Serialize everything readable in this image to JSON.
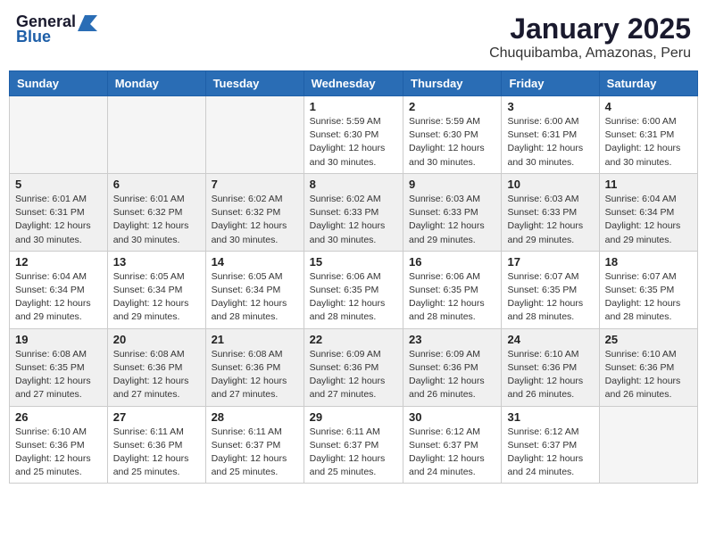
{
  "header": {
    "logo_general": "General",
    "logo_blue": "Blue",
    "month_title": "January 2025",
    "location": "Chuquibamba, Amazonas, Peru"
  },
  "days_of_week": [
    "Sunday",
    "Monday",
    "Tuesday",
    "Wednesday",
    "Thursday",
    "Friday",
    "Saturday"
  ],
  "weeks": [
    [
      {
        "day": "",
        "detail": ""
      },
      {
        "day": "",
        "detail": ""
      },
      {
        "day": "",
        "detail": ""
      },
      {
        "day": "1",
        "detail": "Sunrise: 5:59 AM\nSunset: 6:30 PM\nDaylight: 12 hours\nand 30 minutes."
      },
      {
        "day": "2",
        "detail": "Sunrise: 5:59 AM\nSunset: 6:30 PM\nDaylight: 12 hours\nand 30 minutes."
      },
      {
        "day": "3",
        "detail": "Sunrise: 6:00 AM\nSunset: 6:31 PM\nDaylight: 12 hours\nand 30 minutes."
      },
      {
        "day": "4",
        "detail": "Sunrise: 6:00 AM\nSunset: 6:31 PM\nDaylight: 12 hours\nand 30 minutes."
      }
    ],
    [
      {
        "day": "5",
        "detail": "Sunrise: 6:01 AM\nSunset: 6:31 PM\nDaylight: 12 hours\nand 30 minutes."
      },
      {
        "day": "6",
        "detail": "Sunrise: 6:01 AM\nSunset: 6:32 PM\nDaylight: 12 hours\nand 30 minutes."
      },
      {
        "day": "7",
        "detail": "Sunrise: 6:02 AM\nSunset: 6:32 PM\nDaylight: 12 hours\nand 30 minutes."
      },
      {
        "day": "8",
        "detail": "Sunrise: 6:02 AM\nSunset: 6:33 PM\nDaylight: 12 hours\nand 30 minutes."
      },
      {
        "day": "9",
        "detail": "Sunrise: 6:03 AM\nSunset: 6:33 PM\nDaylight: 12 hours\nand 29 minutes."
      },
      {
        "day": "10",
        "detail": "Sunrise: 6:03 AM\nSunset: 6:33 PM\nDaylight: 12 hours\nand 29 minutes."
      },
      {
        "day": "11",
        "detail": "Sunrise: 6:04 AM\nSunset: 6:34 PM\nDaylight: 12 hours\nand 29 minutes."
      }
    ],
    [
      {
        "day": "12",
        "detail": "Sunrise: 6:04 AM\nSunset: 6:34 PM\nDaylight: 12 hours\nand 29 minutes."
      },
      {
        "day": "13",
        "detail": "Sunrise: 6:05 AM\nSunset: 6:34 PM\nDaylight: 12 hours\nand 29 minutes."
      },
      {
        "day": "14",
        "detail": "Sunrise: 6:05 AM\nSunset: 6:34 PM\nDaylight: 12 hours\nand 28 minutes."
      },
      {
        "day": "15",
        "detail": "Sunrise: 6:06 AM\nSunset: 6:35 PM\nDaylight: 12 hours\nand 28 minutes."
      },
      {
        "day": "16",
        "detail": "Sunrise: 6:06 AM\nSunset: 6:35 PM\nDaylight: 12 hours\nand 28 minutes."
      },
      {
        "day": "17",
        "detail": "Sunrise: 6:07 AM\nSunset: 6:35 PM\nDaylight: 12 hours\nand 28 minutes."
      },
      {
        "day": "18",
        "detail": "Sunrise: 6:07 AM\nSunset: 6:35 PM\nDaylight: 12 hours\nand 28 minutes."
      }
    ],
    [
      {
        "day": "19",
        "detail": "Sunrise: 6:08 AM\nSunset: 6:35 PM\nDaylight: 12 hours\nand 27 minutes."
      },
      {
        "day": "20",
        "detail": "Sunrise: 6:08 AM\nSunset: 6:36 PM\nDaylight: 12 hours\nand 27 minutes."
      },
      {
        "day": "21",
        "detail": "Sunrise: 6:08 AM\nSunset: 6:36 PM\nDaylight: 12 hours\nand 27 minutes."
      },
      {
        "day": "22",
        "detail": "Sunrise: 6:09 AM\nSunset: 6:36 PM\nDaylight: 12 hours\nand 27 minutes."
      },
      {
        "day": "23",
        "detail": "Sunrise: 6:09 AM\nSunset: 6:36 PM\nDaylight: 12 hours\nand 26 minutes."
      },
      {
        "day": "24",
        "detail": "Sunrise: 6:10 AM\nSunset: 6:36 PM\nDaylight: 12 hours\nand 26 minutes."
      },
      {
        "day": "25",
        "detail": "Sunrise: 6:10 AM\nSunset: 6:36 PM\nDaylight: 12 hours\nand 26 minutes."
      }
    ],
    [
      {
        "day": "26",
        "detail": "Sunrise: 6:10 AM\nSunset: 6:36 PM\nDaylight: 12 hours\nand 25 minutes."
      },
      {
        "day": "27",
        "detail": "Sunrise: 6:11 AM\nSunset: 6:36 PM\nDaylight: 12 hours\nand 25 minutes."
      },
      {
        "day": "28",
        "detail": "Sunrise: 6:11 AM\nSunset: 6:37 PM\nDaylight: 12 hours\nand 25 minutes."
      },
      {
        "day": "29",
        "detail": "Sunrise: 6:11 AM\nSunset: 6:37 PM\nDaylight: 12 hours\nand 25 minutes."
      },
      {
        "day": "30",
        "detail": "Sunrise: 6:12 AM\nSunset: 6:37 PM\nDaylight: 12 hours\nand 24 minutes."
      },
      {
        "day": "31",
        "detail": "Sunrise: 6:12 AM\nSunset: 6:37 PM\nDaylight: 12 hours\nand 24 minutes."
      },
      {
        "day": "",
        "detail": ""
      }
    ]
  ]
}
